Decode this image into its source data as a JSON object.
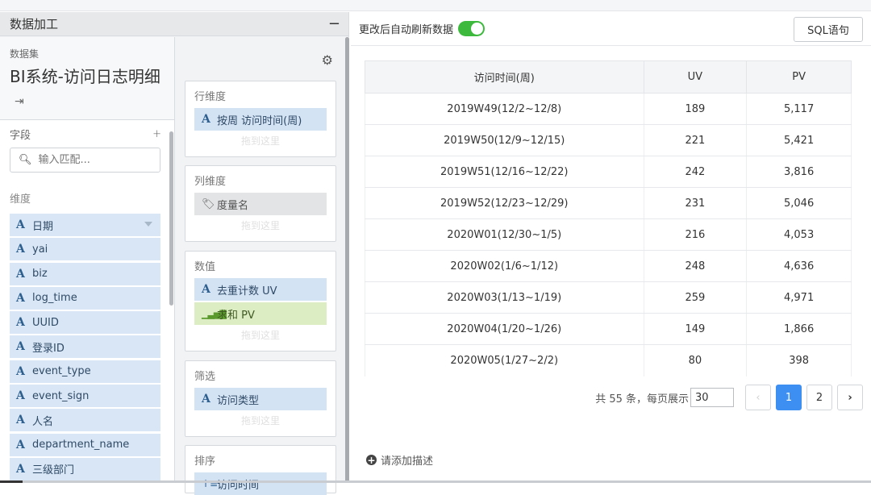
{
  "panel": {
    "title": "数据加工",
    "minimize": "−"
  },
  "dataset": {
    "label": "数据集",
    "name": "BI系统-访问日志明细",
    "exit_icon": "⇥"
  },
  "fields": {
    "header": "字段",
    "add": "+",
    "search_placeholder": "输入匹配...",
    "dim_label": "维度",
    "items": [
      {
        "type_icon": "A",
        "name": "日期"
      },
      {
        "type_icon": "A",
        "name": "yai"
      },
      {
        "type_icon": "A",
        "name": "biz"
      },
      {
        "type_icon": "A",
        "name": "log_time"
      },
      {
        "type_icon": "A",
        "name": "UUID"
      },
      {
        "type_icon": "A",
        "name": "登录ID"
      },
      {
        "type_icon": "A",
        "name": "event_type"
      },
      {
        "type_icon": "A",
        "name": "event_sign"
      },
      {
        "type_icon": "A",
        "name": "人名"
      },
      {
        "type_icon": "A",
        "name": "department_name"
      },
      {
        "type_icon": "A",
        "name": "三级部门"
      }
    ]
  },
  "config": {
    "drop_hint": "拖到这里",
    "row_dim": {
      "title": "行维度",
      "item": "按周 访问时间(周)"
    },
    "col_dim": {
      "title": "列维度",
      "item": "度量名"
    },
    "values": {
      "title": "数值",
      "item1": "去重计数 UV",
      "item2": "求和 PV"
    },
    "filter": {
      "title": "筛选",
      "item": "访问类型"
    },
    "sort": {
      "title": "排序",
      "item": "访问时间"
    }
  },
  "toolbar": {
    "auto_refresh_label": "更改后自动刷新数据",
    "auto_refresh_on": true,
    "sql_button": "SQL语句"
  },
  "table": {
    "headers": [
      "访问时间(周)",
      "UV",
      "PV"
    ],
    "rows": [
      [
        "2019W49(12/2~12/8)",
        "189",
        "5,117"
      ],
      [
        "2019W50(12/9~12/15)",
        "221",
        "5,421"
      ],
      [
        "2019W51(12/16~12/22)",
        "242",
        "3,816"
      ],
      [
        "2019W52(12/23~12/29)",
        "231",
        "5,046"
      ],
      [
        "2020W01(12/30~1/5)",
        "216",
        "4,053"
      ],
      [
        "2020W02(1/6~1/12)",
        "248",
        "4,636"
      ],
      [
        "2020W03(1/13~1/19)",
        "259",
        "4,971"
      ],
      [
        "2020W04(1/20~1/26)",
        "149",
        "1,866"
      ],
      [
        "2020W05(1/27~2/2)",
        "80",
        "398"
      ]
    ]
  },
  "pagination": {
    "summary": "共 55 条，每页展示",
    "page_size": "30",
    "prev": "‹",
    "page1": "1",
    "page2": "2",
    "next": "›"
  },
  "description": {
    "add_label": "请添加描述",
    "add_icon": "+"
  },
  "colors": {
    "accent": "#3d8ff2",
    "toggle_on": "#3dba3d",
    "dim_pill": "#d3e3f4",
    "measure_pill": "#dcedc3"
  }
}
